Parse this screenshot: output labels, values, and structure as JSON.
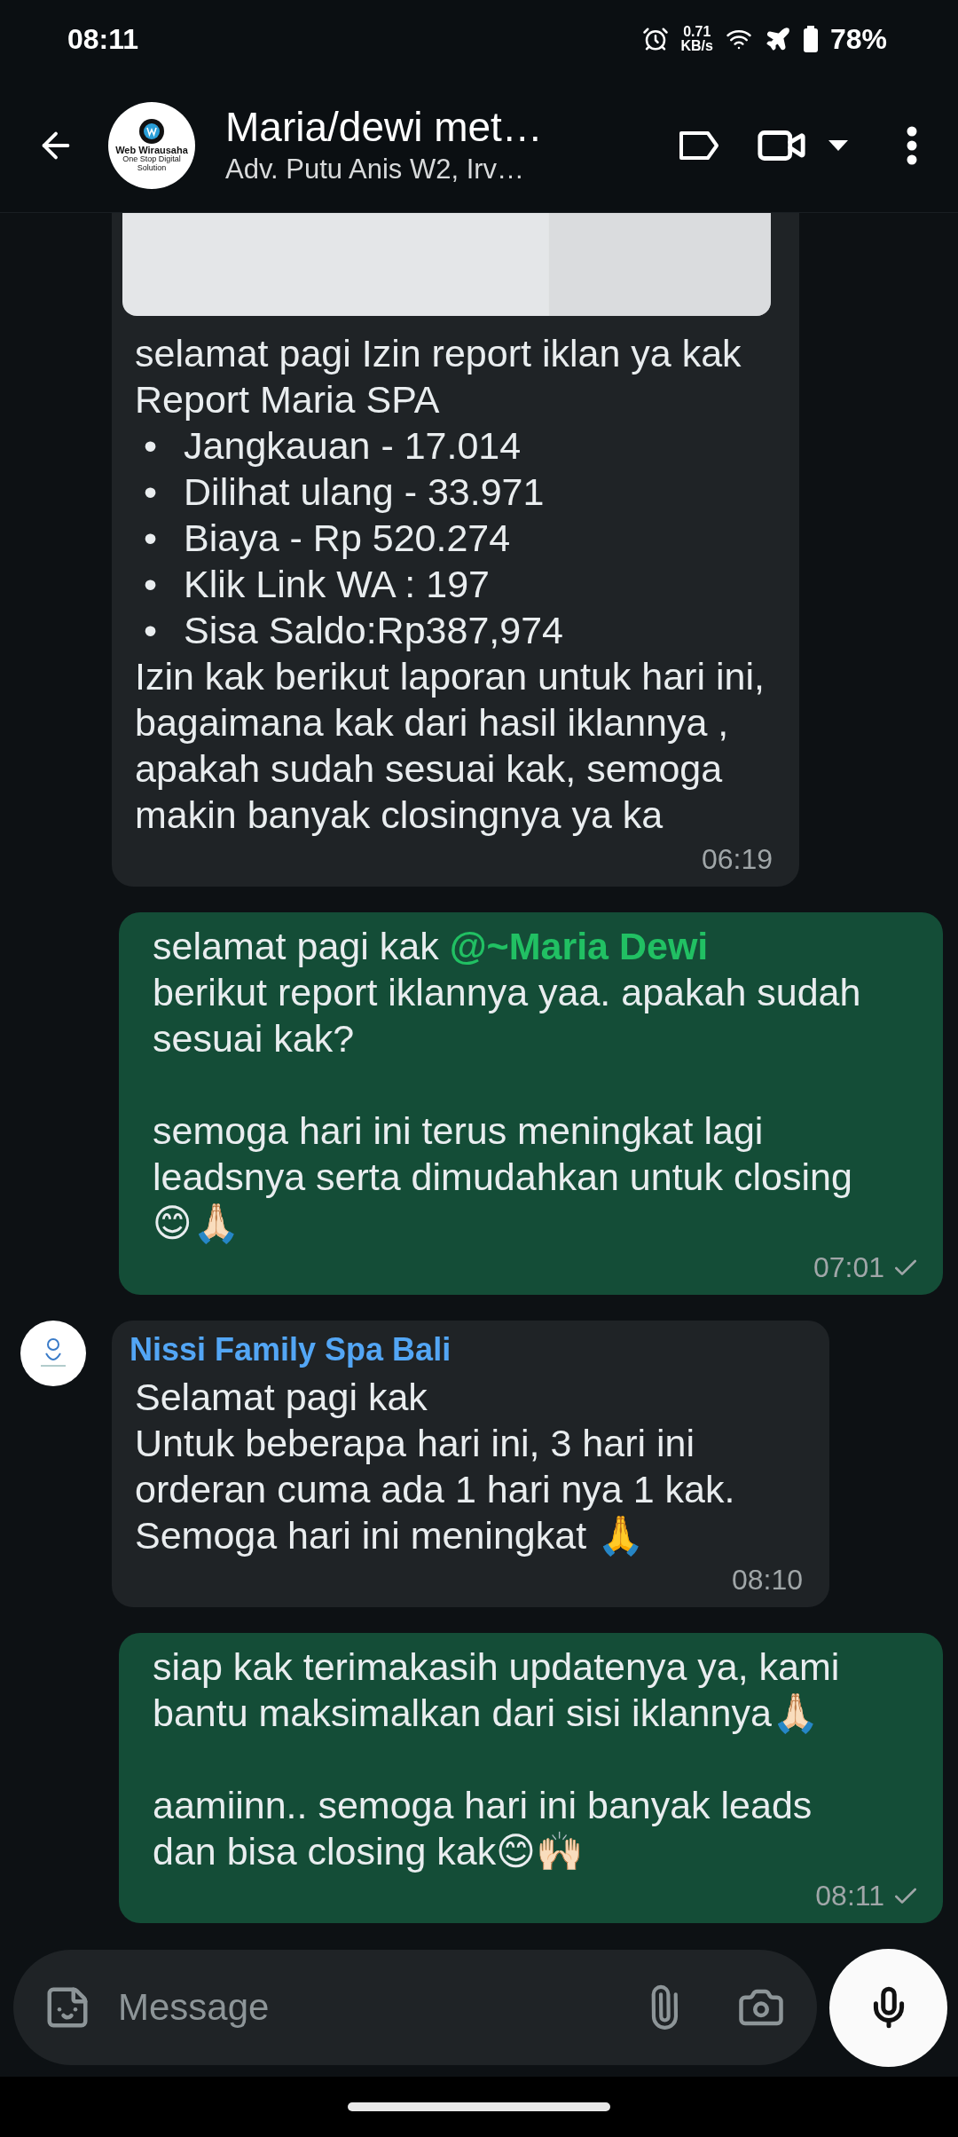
{
  "status_bar": {
    "time": "08:11",
    "net_speed": "0.71",
    "net_unit": "KB/s",
    "battery": "78%"
  },
  "header": {
    "avatar": {
      "name": "Web Wirausaha",
      "tagline": "One Stop Digital Solution"
    },
    "title": "Maria/dewi met…",
    "subtitle": "Adv. Putu Anis W2, Irv…"
  },
  "messages": [
    {
      "outgoing": false,
      "attachment": {
        "kind": "picture"
      },
      "blocks": [
        {
          "kind": "text",
          "text": "selamat pagi Izin report iklan ya kak\nReport Maria SPA"
        },
        {
          "kind": "bullets",
          "marker": "•",
          "items": [
            "Jangkauan - 17.014",
            "Dilihat ulang - 33.971",
            "Biaya - Rp 520.274",
            "Klik Link WA : 197",
            "Sisa Saldo:Rp387,974"
          ]
        },
        {
          "kind": "text",
          "text": "Izin kak berikut laporan untuk hari ini,\nbagaimana kak dari hasil iklannya ,\napakah sudah sesuai kak, semoga\nmakin banyak closingnya ya ka"
        }
      ],
      "time": "06:19"
    },
    {
      "outgoing": true,
      "blocks": [
        {
          "kind": "text",
          "text": "selamat pagi kak **@~Maria Dewi**\nberikut report iklannya yaa. apakah sudah\nsesuai kak?\n\nsemoga hari ini terus meningkat lagi\nleadsnya serta dimudahkan untuk closing\n😊🙏🏻"
        }
      ],
      "time": "07:01",
      "read": false
    },
    {
      "outgoing": false,
      "sender": "Nissi Family Spa Bali",
      "blocks": [
        {
          "kind": "text",
          "text": "Selamat pagi kak\nUntuk beberapa hari ini, 3 hari ini\norderan cuma ada 1 hari nya 1 kak.\nSemoga hari ini meningkat 🙏"
        }
      ],
      "time": "08:10"
    },
    {
      "outgoing": true,
      "blocks": [
        {
          "kind": "text",
          "text": "siap kak terimakasih updatenya ya, kami\nbantu maksimalkan dari sisi iklannya🙏🏻\n\naamiinn.. semoga hari ini banyak leads\ndan bisa closing kak😊🙌🏻"
        }
      ],
      "time": "08:11",
      "read": false
    }
  ],
  "composer": {
    "placeholder": "Message"
  }
}
